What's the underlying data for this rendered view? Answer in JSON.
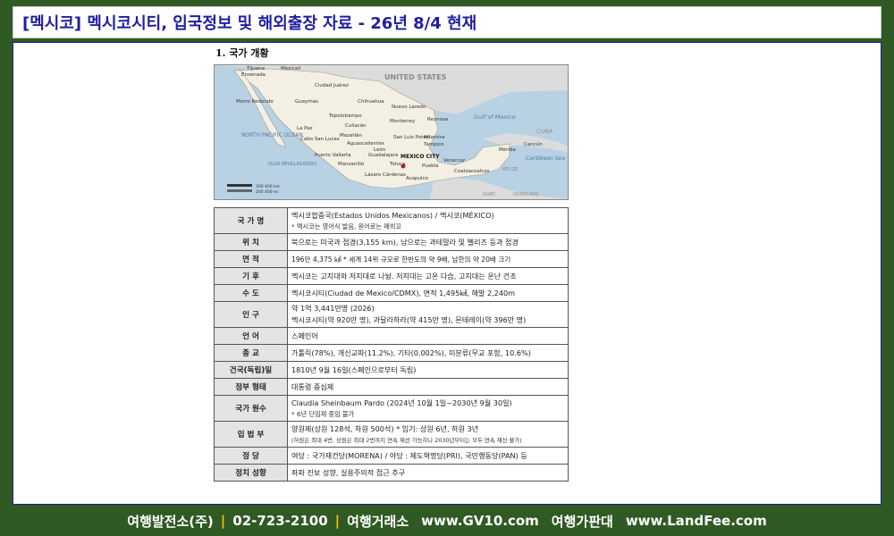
{
  "header": {
    "title": "[멕시코] 멕시코시티, 입국정보 및 해외출장 자료 - 26년 8/4 현재"
  },
  "section": {
    "heading": "1. 국가 개황"
  },
  "map": {
    "labels": {
      "us": "UNITED STATES",
      "tijuana": "Tijuana",
      "mexicali": "Mexicali",
      "ensenada": "Ensenada",
      "ciudad_juarez": "Ciudad Juárez",
      "chihuahua": "Chihuahua",
      "guaymas": "Guaymas",
      "nuevo_laredo": "Nuevo Laredo",
      "morro_redondo": "Morro Redondo",
      "topolobampo": "Topolobampo",
      "monterrey": "Monterrey",
      "reynosa": "Reynosa",
      "gulf": "Gulf of Mexico",
      "cuba": "CUBA",
      "la_paz": "La Paz",
      "culiacan": "Culiacán",
      "cabo": "Cabo San Lucas",
      "mazatlan": "Mazatlán",
      "aguascalientes": "Aguascalientes",
      "san_luis_potosi": "San Luis Potosí",
      "altamira": "Altamira",
      "tampico": "Tampico",
      "north_pacific": "NORTH PACIFIC OCEAN",
      "leon": "León",
      "guadalajara": "Guadalajara",
      "puerto_vallarta": "Puerto Vallarta",
      "mexico_city": "MEXICO CITY",
      "toluca": "Toluca",
      "puebla": "Puebla",
      "veracruz": "Veracruz",
      "cancun": "Cancún",
      "merida": "Mérida",
      "manzanillo": "Manzanillo",
      "islas": "ISLAS REVILLAGIGEDO",
      "lazaro": "Lázaro Cárdenas",
      "acapulco": "Acapulco",
      "coatzacoalcos": "Coatzacoalcos",
      "caribbean": "Caribbean Sea",
      "belize": "BELIZE",
      "guatemala": "GUAT.",
      "honduras": "HONDURAS",
      "scale_km": "200   400 km",
      "scale_mi": "200   400 mi"
    }
  },
  "info_table": [
    {
      "key": "국 가 명",
      "value": "멕시코합중국(Estados Unidos Mexicanos) / 멕시코(MÉXICO)",
      "note": "* 멕시코는 영어식 발음, 원어로는 메히꼬"
    },
    {
      "key": "위    치",
      "value": "북으로는 미국과 접경(3,155 km), 남으로는 과테말라 및 벨리즈 등과 접경"
    },
    {
      "key": "면    적",
      "value": "196만 4,375 ㎢ * 세계 14위 규모로 한반도의 약 9배, 남한의 약 20배 크기"
    },
    {
      "key": "기    후",
      "value": "멕시코는 고지대와 저지대로 나뉨. 저지대는 고온 다습, 고지대는 온난 건조"
    },
    {
      "key": "수    도",
      "value": "멕시코시티(Ciudad de Mexico/CDMX), 면적 1,495㎢, 해발 2,240m"
    },
    {
      "key": "인    구",
      "value": "약 1억 3,441만명 (2026)",
      "value2": "멕시코시티(약 920만 명), 과달라하라(약 415만 명), 몬테레이(약 396만 명)"
    },
    {
      "key": "언    어",
      "value": "스페인어"
    },
    {
      "key": "종    교",
      "value": "가톨릭(78%), 개신교파(11.2%), 기타(0.002%), 미분류(무교 포함, 10.6%)"
    },
    {
      "key": "건국(독립)일",
      "value": "1810년 9월 16일(스페인으로부터 독립)"
    },
    {
      "key": "정부 형태",
      "value": "대통령 중심제"
    },
    {
      "key": "국가 원수",
      "value": "Claudia Sheinbaum Pardo (2024년 10월 1일~2030년 9월 30일)",
      "note": "* 6년 단임제 중임 불가"
    },
    {
      "key": "입 법 부",
      "value": "양원제(상원 128석, 하원 500석) * 임기: 상원 6년, 하원 3년",
      "note": "(하원은 최대 4번, 상원은 최대 2번까지 연속 재선 가능하나 2030년부터는 모두 연속 재선 불가)"
    },
    {
      "key": "정    당",
      "value": "여당 : 국가재건당(MORENA) / 야당 : 제도혁명당(PRI), 국민행동당(PAN) 등"
    },
    {
      "key": "정치 성향",
      "value": "좌파 진보 성향, 실용주의적 접근 추구"
    }
  ],
  "footer": {
    "company": "여행발전소(주)",
    "sep": "|",
    "phone": "02-723-2100",
    "site1_name": "여행거래소",
    "site1_url": "www.GV10.com",
    "site2_name": "여행가판대",
    "site2_url": "www.LandFee.com"
  },
  "colors": {
    "background": "#2f5a23",
    "title_text": "#1f1f9f",
    "accent": "#f5c400",
    "land_mexico": "#f3efe2",
    "land_other": "#dcdcdc",
    "sea": "#b8d2e4"
  }
}
